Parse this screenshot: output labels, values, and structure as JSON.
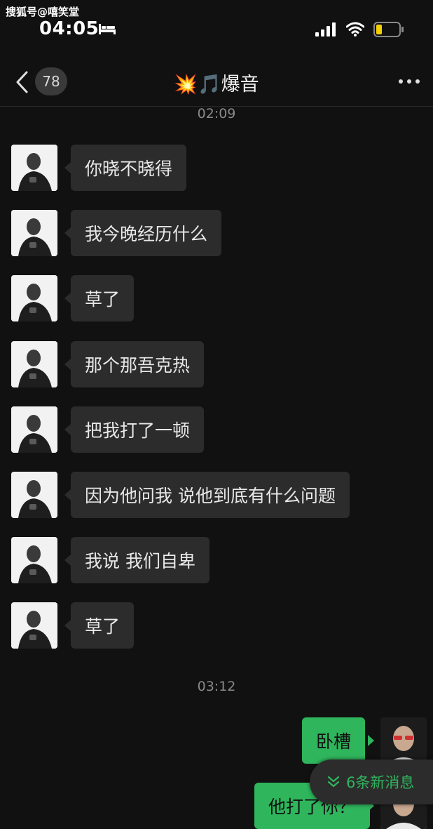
{
  "watermark": "搜狐号@嘻笑堂",
  "status_bar": {
    "time": "04:05"
  },
  "nav": {
    "unread_count": "78",
    "title": "💥🎵爆音"
  },
  "timestamps": [
    "02:09",
    "03:12"
  ],
  "incoming_messages": [
    "你晓不晓得",
    "我今晚经历什么",
    "草了",
    "那个那吾克热",
    "把我打了一顿",
    "因为他问我 说他到底有什么问题",
    "我说 我们自卑",
    "草了"
  ],
  "outgoing_messages": [
    "卧槽",
    "他打了你？"
  ],
  "new_messages_pill": "6条新消息",
  "colors": {
    "background": "#111111",
    "incoming_bubble": "#2c2c2c",
    "outgoing_bubble": "#2fb55c",
    "accent": "#2fb55c"
  }
}
